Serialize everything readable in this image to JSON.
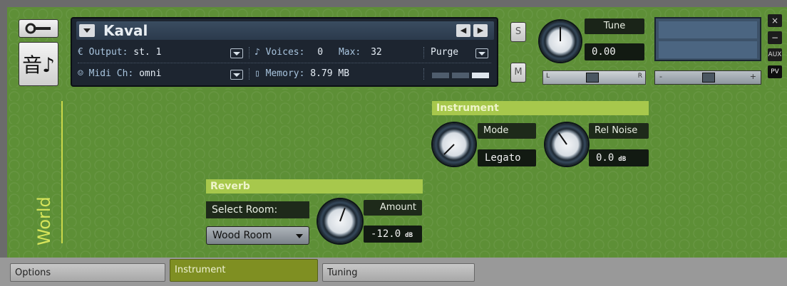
{
  "header": {
    "instrument_name": "Kaval",
    "output_label": "Output:",
    "output_value": "st. 1",
    "voices_label": "Voices:",
    "voices_value": "0",
    "max_label": "Max:",
    "max_value": "32",
    "purge_label": "Purge",
    "midi_label": "Midi Ch:",
    "midi_value": "omni",
    "memory_label": "Memory:",
    "memory_value": "8.79 MB",
    "solo_label": "S",
    "mute_label": "M",
    "tune_label": "Tune",
    "tune_value": "0.00",
    "pan_left": "L",
    "pan_right": "R",
    "vol_minus": "-",
    "vol_plus": "+",
    "close_label": "×",
    "minimize_label": "−",
    "aux_label": "AUX",
    "pv_label": "PV",
    "instrument_icon": "音♪"
  },
  "world_label": "World",
  "instrument_section": {
    "title": "Instrument",
    "mode_label": "Mode",
    "mode_value": "Legato",
    "relnoise_label": "Rel Noise",
    "relnoise_value": "0.0",
    "relnoise_unit": "dB"
  },
  "reverb_section": {
    "title": "Reverb",
    "select_room_label": "Select Room:",
    "room_value": "Wood Room",
    "amount_label": "Amount",
    "amount_value": "-12.0",
    "amount_unit": "dB"
  },
  "tabs": [
    {
      "label": "Options"
    },
    {
      "label": "Instrument"
    },
    {
      "label": "Tuning"
    }
  ],
  "icons": {
    "wrench": "wrench-icon",
    "instrument": "instrument-icon",
    "voices": "voices-icon",
    "memory": "memory-icon",
    "midi": "midi-icon",
    "output": "output-icon"
  },
  "colors": {
    "background_green": "#5d8f36",
    "section_bar": "#a7c84c",
    "active_tab": "#7f8f22",
    "panel_dark": "#1d2530"
  }
}
